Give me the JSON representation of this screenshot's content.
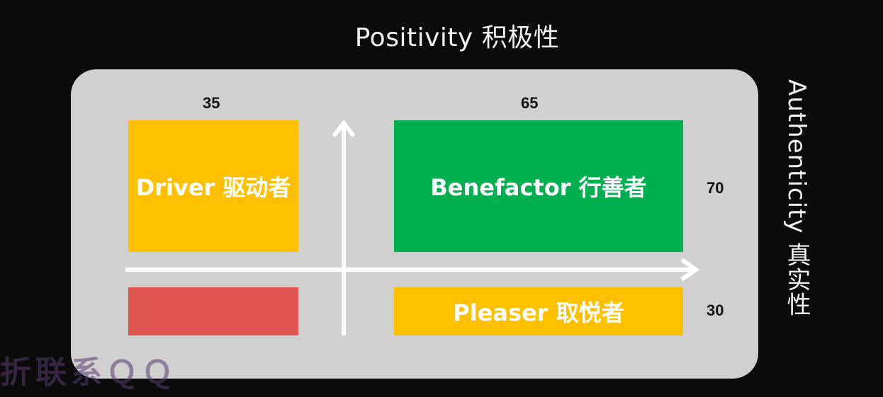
{
  "diagram": {
    "title": "Positivity 积极性",
    "side_title": "Authenticity 真实性",
    "col_values": [
      "35",
      "65"
    ],
    "row_values": [
      "70",
      "30"
    ],
    "quadrants": {
      "top_left": {
        "label": "Driver 驱动者",
        "color": "#ffc000"
      },
      "top_right": {
        "label": "Benefactor 行善者",
        "color": "#00b050"
      },
      "bottom_left": {
        "label": "",
        "color": "#e05552"
      },
      "bottom_right": {
        "label": "Pleaser 取悦者",
        "color": "#ffc000"
      }
    },
    "panel_color": "#d0d0d0",
    "axis_color": "#ffffff"
  },
  "watermark": "折联系ＱＱ"
}
